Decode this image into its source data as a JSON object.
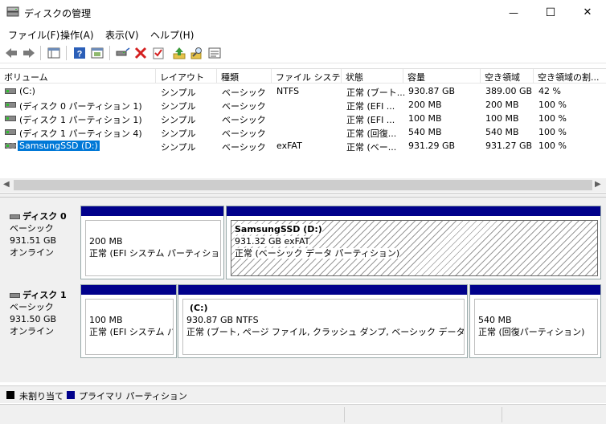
{
  "window": {
    "title": "ディスクの管理",
    "controls": {
      "minimize": "—",
      "maximize": "☐",
      "close": "✕"
    }
  },
  "menu": [
    {
      "label": "ファイル(F)"
    },
    {
      "label": "操作(A)"
    },
    {
      "label": "表示(V)"
    },
    {
      "label": "ヘルプ(H)"
    }
  ],
  "toolbar_icons": [
    "back-icon",
    "forward-icon",
    "console-tree-icon",
    "help-icon",
    "properties-icon",
    "connect-icon",
    "delete-icon",
    "check-icon",
    "up-icon",
    "search-icon",
    "list-icon"
  ],
  "columns": [
    "ボリューム",
    "レイアウト",
    "種類",
    "ファイル システム",
    "状態",
    "容量",
    "空き領域",
    "空き領域の割..."
  ],
  "volumes": [
    {
      "name": "(C:)",
      "layout": "シンプル",
      "type": "ベーシック",
      "fs": "NTFS",
      "status": "正常 (ブート...",
      "capacity": "930.87 GB",
      "free": "389.00 GB",
      "pct": "42 %"
    },
    {
      "name": "(ディスク 0 パーティション 1)",
      "layout": "シンプル",
      "type": "ベーシック",
      "fs": "",
      "status": "正常 (EFI ...",
      "capacity": "200 MB",
      "free": "200 MB",
      "pct": "100 %"
    },
    {
      "name": "(ディスク 1 パーティション 1)",
      "layout": "シンプル",
      "type": "ベーシック",
      "fs": "",
      "status": "正常 (EFI ...",
      "capacity": "100 MB",
      "free": "100 MB",
      "pct": "100 %"
    },
    {
      "name": "(ディスク 1 パーティション 4)",
      "layout": "シンプル",
      "type": "ベーシック",
      "fs": "",
      "status": "正常 (回復...",
      "capacity": "540 MB",
      "free": "540 MB",
      "pct": "100 %"
    },
    {
      "name": "SamsungSSD (D:)",
      "layout": "シンプル",
      "type": "ベーシック",
      "fs": "exFAT",
      "status": "正常 (ベー...",
      "capacity": "931.29 GB",
      "free": "931.27 GB",
      "pct": "100 %"
    }
  ],
  "disks": [
    {
      "title": "ディスク 0",
      "type": "ベーシック",
      "size": "931.51 GB",
      "state": "オンライン",
      "partitions": [
        {
          "name": "",
          "line1": "200 MB",
          "line2": "正常 (EFI システム パーティション)"
        },
        {
          "name": "SamsungSSD  (D:)",
          "line1": "931.32 GB exFAT",
          "line2": "正常 (ベーシック データ パーティション)"
        }
      ]
    },
    {
      "title": "ディスク 1",
      "type": "ベーシック",
      "size": "931.50 GB",
      "state": "オンライン",
      "partitions": [
        {
          "name": "",
          "line1": "100 MB",
          "line2": "正常 (EFI システム パー"
        },
        {
          "name": "(C:)",
          "line1": "930.87 GB NTFS",
          "line2": "正常 (ブート, ページ ファイル, クラッシュ ダンプ, ベーシック データ パーティション)"
        },
        {
          "name": "",
          "line1": "540 MB",
          "line2": "正常 (回復パーティション)"
        }
      ]
    }
  ],
  "legend": {
    "unallocated": "未割り当て",
    "primary": "プライマリ パーティション"
  },
  "colors": {
    "primary": "#00008b",
    "unallocated": "#000000",
    "selection": "#0078d7"
  }
}
